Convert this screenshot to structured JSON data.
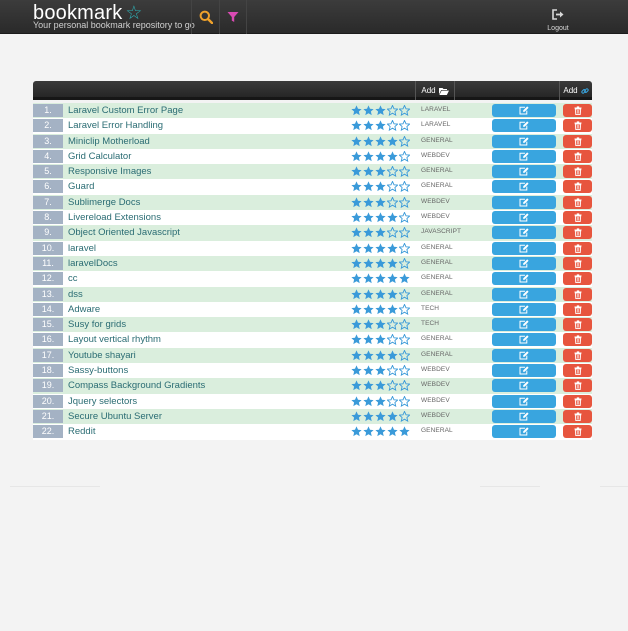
{
  "header": {
    "brand": "bookmark",
    "tagline": "Your personal bookmark repository to go",
    "logout_label": "Logout"
  },
  "table": {
    "add_bookmark_label": "Add",
    "add_link_label": "Add"
  },
  "colors": {
    "star": "#3a9ad9",
    "edit": "#39a5df",
    "delete": "#e7553e",
    "row_alt": "#daeedd",
    "brand_star": "#2fb0b5",
    "search_icon": "#f0a22b",
    "filter_icon": "#d94ab3"
  },
  "rows": [
    {
      "num": "1.",
      "title": "Laravel Custom Error Page",
      "rating": 3,
      "category": "LARAVEL"
    },
    {
      "num": "2.",
      "title": "Laravel Error Handling",
      "rating": 3,
      "category": "LARAVEL"
    },
    {
      "num": "3.",
      "title": "Miniclip Motherload",
      "rating": 4,
      "category": "GENERAL"
    },
    {
      "num": "4.",
      "title": "Grid Calculator",
      "rating": 4,
      "category": "WEBDEV"
    },
    {
      "num": "5.",
      "title": "Responsive Images",
      "rating": 3,
      "category": "GENERAL"
    },
    {
      "num": "6.",
      "title": "Guard",
      "rating": 3,
      "category": "GENERAL"
    },
    {
      "num": "7.",
      "title": "Sublimerge Docs",
      "rating": 3,
      "category": "WEBDEV"
    },
    {
      "num": "8.",
      "title": "Livereload Extensions",
      "rating": 4,
      "category": "WEBDEV"
    },
    {
      "num": "9.",
      "title": "Object Oriented Javascript",
      "rating": 3,
      "category": "JAVASCRIPT"
    },
    {
      "num": "10.",
      "title": "laravel",
      "rating": 4,
      "category": "GENERAL"
    },
    {
      "num": "11.",
      "title": "laravelDocs",
      "rating": 4,
      "category": "GENERAL"
    },
    {
      "num": "12.",
      "title": "cc",
      "rating": 5,
      "category": "GENERAL"
    },
    {
      "num": "13.",
      "title": "dss",
      "rating": 4,
      "category": "GENERAL"
    },
    {
      "num": "14.",
      "title": "Adware",
      "rating": 4,
      "category": "TECH"
    },
    {
      "num": "15.",
      "title": "Susy for grids",
      "rating": 3,
      "category": "TECH"
    },
    {
      "num": "16.",
      "title": "Layout vertical rhythm",
      "rating": 3,
      "category": "GENERAL"
    },
    {
      "num": "17.",
      "title": "Youtube shayari",
      "rating": 4,
      "category": "GENERAL"
    },
    {
      "num": "18.",
      "title": "Sassy-buttons",
      "rating": 3,
      "category": "WEBDEV"
    },
    {
      "num": "19.",
      "title": "Compass Background Gradients",
      "rating": 3,
      "category": "WEBDEV"
    },
    {
      "num": "20.",
      "title": "Jquery selectors",
      "rating": 3,
      "category": "WEBDEV"
    },
    {
      "num": "21.",
      "title": "Secure Ubuntu Server",
      "rating": 4,
      "category": "WEBDEV"
    },
    {
      "num": "22.",
      "title": "Reddit",
      "rating": 5,
      "category": "GENERAL"
    }
  ]
}
